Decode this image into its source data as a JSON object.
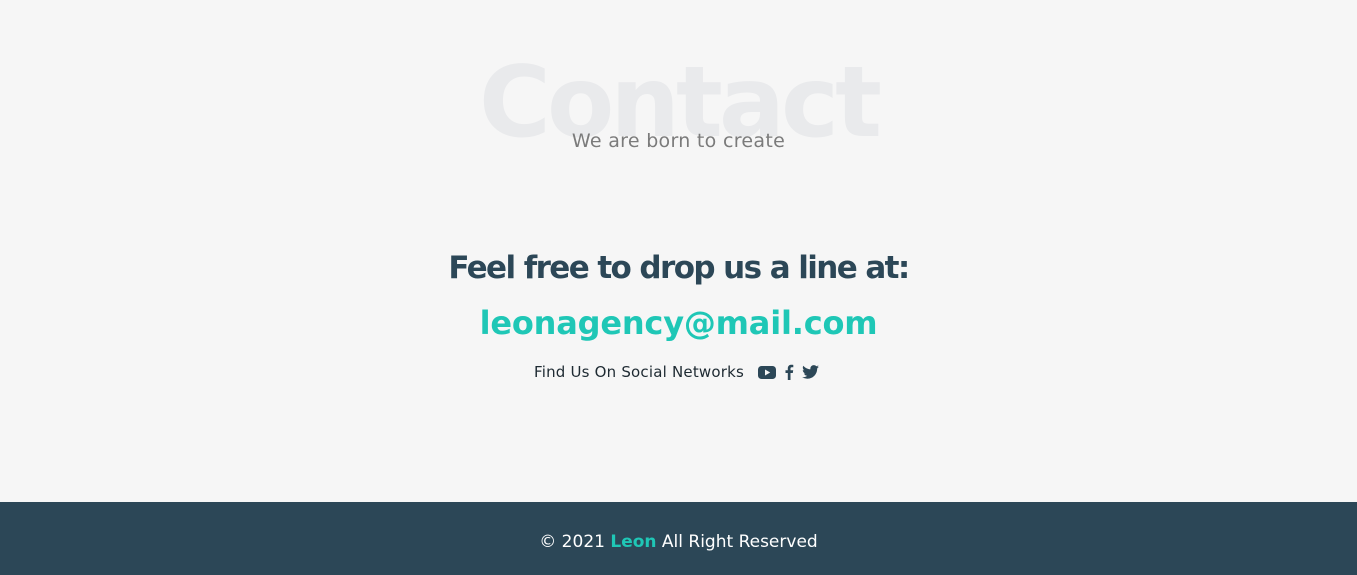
{
  "contact": {
    "background_title": "Contact",
    "subtitle": "We are born to create",
    "headline": "Feel free to drop us a line at:",
    "email": "leonagency@mail.com",
    "social_label": "Find Us On Social Networks",
    "social_icons": [
      "youtube-icon",
      "facebook-icon",
      "twitter-icon"
    ]
  },
  "footer": {
    "copyright_prefix": "© 2021",
    "brand": "Leon",
    "copyright_suffix": "All Right Reserved"
  },
  "colors": {
    "page_background": "#f6f6f6",
    "heading": "#2c4757",
    "accent": "#1fc7b6",
    "footer_background": "#2c4757",
    "subtitle": "#7b7b7b",
    "watermark": "#e9eaec"
  }
}
